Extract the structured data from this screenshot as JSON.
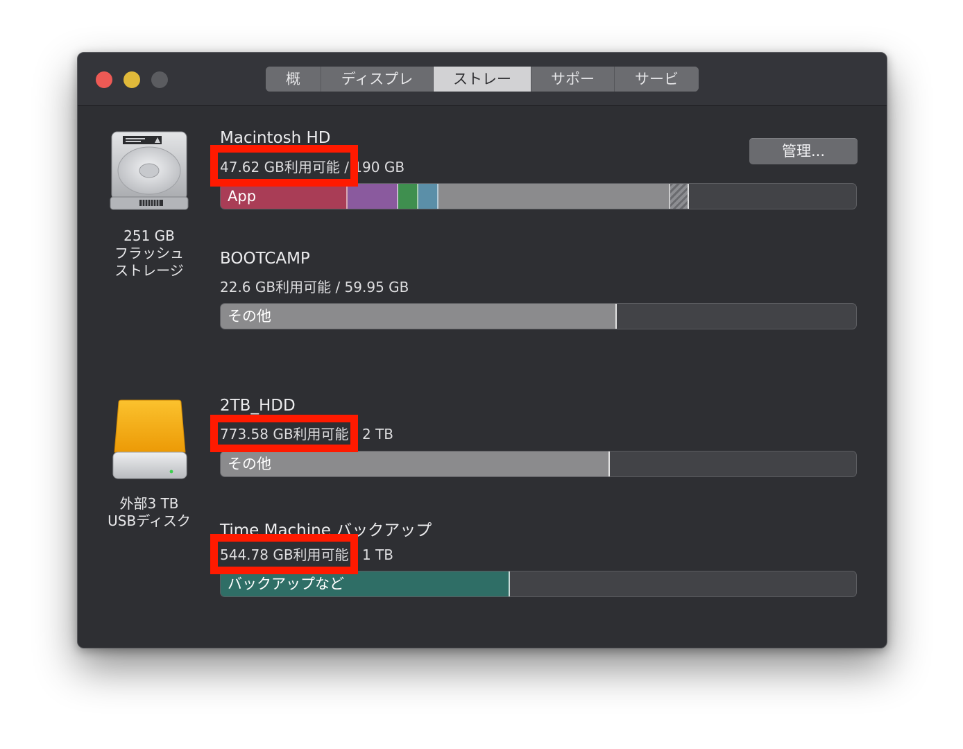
{
  "tabs": [
    {
      "label": "概要"
    },
    {
      "label": "ディスプレイ"
    },
    {
      "label": "ストレージ"
    },
    {
      "label": "サポート"
    },
    {
      "label": "サービス"
    }
  ],
  "active_tab": "ストレージ",
  "internal_disk": {
    "label_line1": "251 GB",
    "label_line2": "フラッシュ",
    "label_line3": "ストレージ",
    "manage_label": "管理...",
    "volumes": [
      {
        "name": "Macintosh HD",
        "capacity": "47.62 GB利用可能 / 190 GB",
        "segments": [
          {
            "label": "App",
            "color": "#a93d56",
            "fraction": 0.2
          },
          {
            "color": "#8a5a9e",
            "fraction": 0.08
          },
          {
            "color": "#3f8f4f",
            "fraction": 0.032
          },
          {
            "color": "#5b8fa8",
            "fraction": 0.032
          },
          {
            "color": "#8b8b8d",
            "fraction": 0.365
          },
          {
            "color": "hatched",
            "fraction": 0.03
          }
        ]
      },
      {
        "name": "BOOTCAMP",
        "capacity": "22.6 GB利用可能 / 59.95 GB",
        "segments": [
          {
            "label": "その他",
            "color": "#8b8b8d",
            "fraction": 0.623
          }
        ]
      }
    ]
  },
  "external_disk": {
    "label_line1": "外部3 TB",
    "label_line2": "USBディスク",
    "volumes": [
      {
        "name": "2TB_HDD",
        "capacity": "773.58 GB利用可能 / 2 TB",
        "segments": [
          {
            "label": "その他",
            "color": "#8b8b8d",
            "fraction": 0.612
          }
        ]
      },
      {
        "name": "Time Machine バックアップ",
        "capacity": "544.78 GB利用可能 / 1 TB",
        "segments": [
          {
            "label": "バックアップなど",
            "color": "#2f6e66",
            "fraction": 0.455
          }
        ]
      }
    ]
  },
  "colors": {
    "window_bg": "#2e2f33",
    "redaction": "#ff1a00"
  }
}
